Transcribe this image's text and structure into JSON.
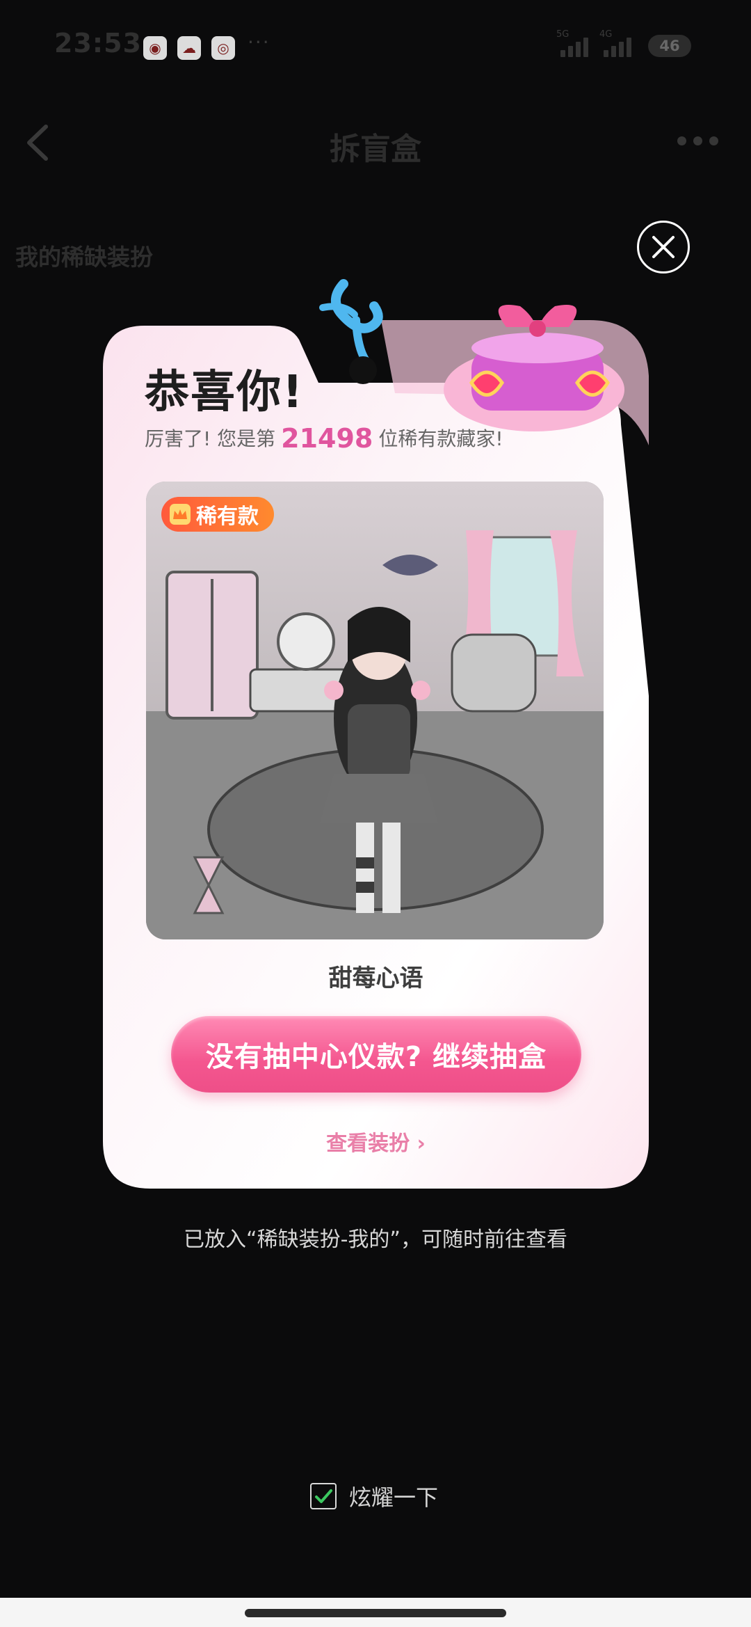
{
  "status_bar": {
    "time": "23:53",
    "apps": [
      "weibo-icon",
      "app-icon-2",
      "app-icon-3"
    ],
    "more": "···",
    "signal_1_label": "5G",
    "signal_2_label": "4G",
    "battery": "46"
  },
  "nav": {
    "title": "拆盲盒"
  },
  "section": {
    "title": "我的稀缺装扮"
  },
  "card": {
    "title": "恭喜你!",
    "subtitle_prefix": "厉害了! 您是第",
    "rank": "21498",
    "subtitle_suffix": "位稀有款藏家!",
    "badge_label": "稀有款",
    "item_name": "甜莓心语",
    "primary_button": "没有抽中心仪款? 继续抽盒",
    "view_link": "查看装扮 ›"
  },
  "footnote": "已放入“稀缺装扮-我的”，可随时前往查看",
  "share": {
    "label": "炫耀一下",
    "checked": true
  },
  "colors": {
    "accent_pink": "#f4568f",
    "rank_pink": "#e0559e",
    "badge_orange": "#ff6a34",
    "check_green": "#3cc860"
  }
}
